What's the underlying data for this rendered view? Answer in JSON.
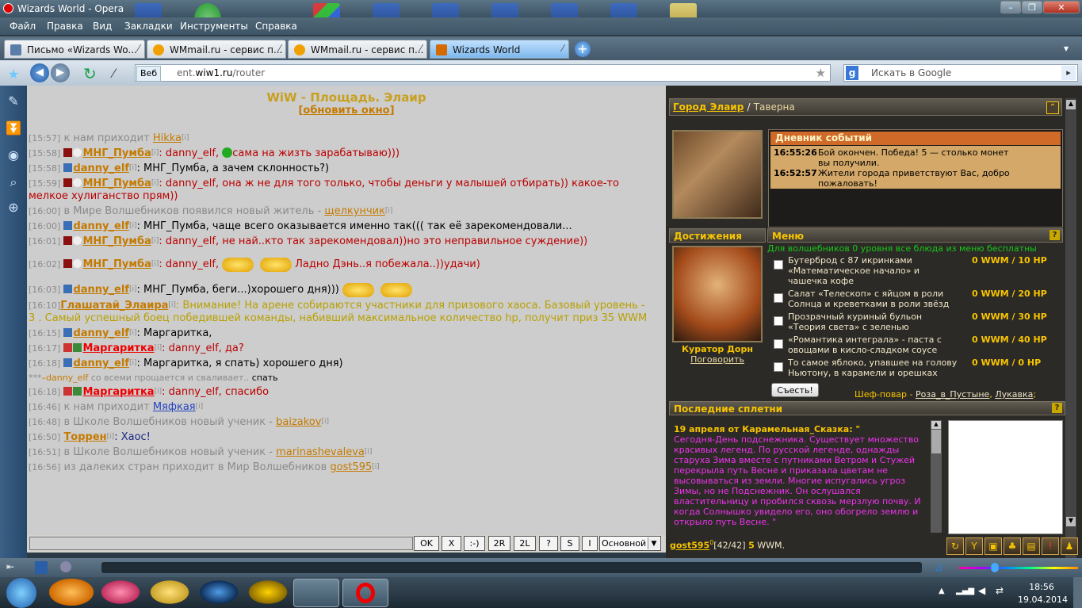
{
  "window": {
    "title": "Wizards World - Opera"
  },
  "menu": [
    "Файл",
    "Правка",
    "Вид",
    "Закладки",
    "Инструменты",
    "Справка"
  ],
  "tabs": [
    {
      "label": "Письмо «Wizards Wo..."
    },
    {
      "label": "WMmail.ru - сервис п..."
    },
    {
      "label": "WMmail.ru - сервис п..."
    },
    {
      "label": "Wizards World"
    }
  ],
  "address": {
    "chip": "Веб",
    "url_prefix": "ent.",
    "url_host": "wiw1.ru",
    "url_path": "/router",
    "search_placeholder": "Искать в Google"
  },
  "chat": {
    "title": "WiW - Площадь. Элаир",
    "refresh": "обновить окно",
    "messages": [
      {
        "time": "[15:57]",
        "pre": "к нам приходит",
        "nick": "Hikka",
        "text": "",
        "kind": "sys"
      },
      {
        "time": "[15:58]",
        "nick": "МНГ_Пумба",
        "text": ": danny_elf,",
        "text2": "сама на жизть зарабатываю)))",
        "kind": "red"
      },
      {
        "time": "[15:58]",
        "nick": "danny_elf",
        "text": ": МНГ_Пумба, а зачем склонность?)",
        "kind": "black"
      },
      {
        "time": "[15:59]",
        "nick": "МНГ_Пумба",
        "text": ": danny_elf, она ж не для того только, чтобы деньги у малышей отбирать)) какое-то",
        "text2": "мелкое хулиганство прям))",
        "kind": "red"
      },
      {
        "time": "[16:00]",
        "pre": "в Мире Волшебников появился новый житель -",
        "nick": "щелкунчик",
        "text": "",
        "kind": "sys"
      },
      {
        "time": "[16:00]",
        "nick": "danny_elf",
        "text": ": МНГ_Пумба, чаще всего оказывается именно так((( так её зарекомендовали...",
        "kind": "black"
      },
      {
        "time": "[16:01]",
        "nick": "МНГ_Пумба",
        "text": ": danny_elf, не най..кто так зарекомендовал))но это неправильное суждение))",
        "kind": "red"
      },
      {
        "time": "[16:02]",
        "nick": "МНГ_Пумба",
        "text": ": danny_elf,",
        "text2": "Ладно Дэнь..я побежала..))удачи)",
        "kind": "red"
      },
      {
        "time": "[16:03]",
        "nick": "danny_elf",
        "text": ": МНГ_Пумба, беги...)хорошего дня)))",
        "kind": "black"
      },
      {
        "time": "[16:10]",
        "nick": "Глашатай_Элаира",
        "text": ": Внимание! На арене собираются участники для призового хаоса. Базовый уровень -",
        "text2": "3 . Самый успешный боец победившей команды, набивший максимальное количество hp, получит приз 35 WWM",
        "kind": "ann"
      },
      {
        "time": "[16:15]",
        "nick": "danny_elf",
        "text": ": Маргаритка,",
        "kind": "black"
      },
      {
        "time": "[16:17]",
        "nick": "Маргаритка",
        "text": ": danny_elf, да?",
        "kind": "red"
      },
      {
        "time": "[16:18]",
        "nick": "danny_elf",
        "text": ": Маргаритка, я спать) хорошего дня)",
        "kind": "black"
      },
      {
        "time": "***",
        "nick": "–danny_elf",
        "text": "со всеми прощается и сваливает..",
        "text2": "спать",
        "kind": "emote"
      },
      {
        "time": "[16:18]",
        "nick": "Маргаритка",
        "text": ": danny_elf, спасибо",
        "kind": "red"
      },
      {
        "time": "[16:46]",
        "pre": "к нам приходит",
        "nick": "Мяфкая",
        "text": "",
        "kind": "sys"
      },
      {
        "time": "[16:48]",
        "pre": "в Школе Волшебников новый ученик -",
        "nick": "baizakov",
        "text": "",
        "kind": "sys"
      },
      {
        "time": "[16:50]",
        "nick": "Торрен",
        "text": ": Хаос!",
        "kind": "black"
      },
      {
        "time": "[16:51]",
        "pre": "в Школе Волшебников новый ученик -",
        "nick": "marinashevaleva",
        "text": "",
        "kind": "sys"
      },
      {
        "time": "[16:56]",
        "pre": "из далеких стран приходит в Мир Волшебников",
        "nick": "gost595",
        "text": "",
        "kind": "sys"
      }
    ],
    "info_mark": "[i]",
    "buttons": [
      "OK",
      "X",
      ":-)",
      "2R",
      "2L",
      "?",
      "S",
      "I"
    ],
    "channel": "Основной"
  },
  "right": {
    "location_city": "Город Элаир",
    "location_sep": "/",
    "location_place": "Таверна",
    "events_title": "Дневник событий",
    "events": [
      {
        "time": "16:55:26",
        "text": "Бой окончен. Победа! 5 — столько монет вы получили."
      },
      {
        "time": "16:52:57",
        "text": "Жители города приветствуют Вас, добро пожаловать!"
      }
    ],
    "achievements_title": "Достижения",
    "npc_name": "Куратор Дорн",
    "npc_talk": "Поговорить",
    "menu_title": "Меню",
    "menu_note": "Для волшебников 0 уровня все блюда из меню бесплатны",
    "menu_items": [
      {
        "name": "Бутерброд с 87 икринками «Математическое начало» и чашечка кофе",
        "price": "0 WWM / 10 HP"
      },
      {
        "name": "Салат «Телескоп» с яйцом в роли Солнца и креветками в роли звёзд",
        "price": "0 WWM / 20 HP"
      },
      {
        "name": "Прозрачный куриный бульон «Теория света» с зеленью",
        "price": "0 WWM / 30 HP"
      },
      {
        "name": "«Романтика интеграла» - паста с овощами в кисло-сладком соусе",
        "price": "0 WWM / 40 HP"
      },
      {
        "name": "То самое яблоко, упавшее на голову Ньютону, в карамели и орешках",
        "price": "0 WWM / 0 HP"
      }
    ],
    "eat_button": "Съесть!",
    "chef_label": "Шеф-повар -",
    "chef_1": "Роза_в_Пустыне",
    "chef_2": "Лукавка",
    "chef_end": ";",
    "gossip_title": "Последние сплетни",
    "gossip_head": "19 апреля от Карамельная_Сказка: \"",
    "gossip_text": "Сегодня-День подснежника. Существует множество красивых легенд. По русской легенде, однажды старуха Зима вместе с путниками Ветром и Стужей перекрыла путь Весне и приказала цветам не высовываться из земли. Многие испугались угроз Зимы, но не Подснежник. Он ослушался властительницу и пробился сквозь мерзлую почву. И когда Солнышко увидело его, оно обогрело землю и открыло путь Весне. \"",
    "player": "gost595",
    "player_level": "0",
    "player_hp": "[42/42]",
    "player_wwm": "5",
    "player_wwm_unit": "WWM."
  },
  "taskbar": {
    "time": "18:56",
    "date": "19.04.2014"
  }
}
